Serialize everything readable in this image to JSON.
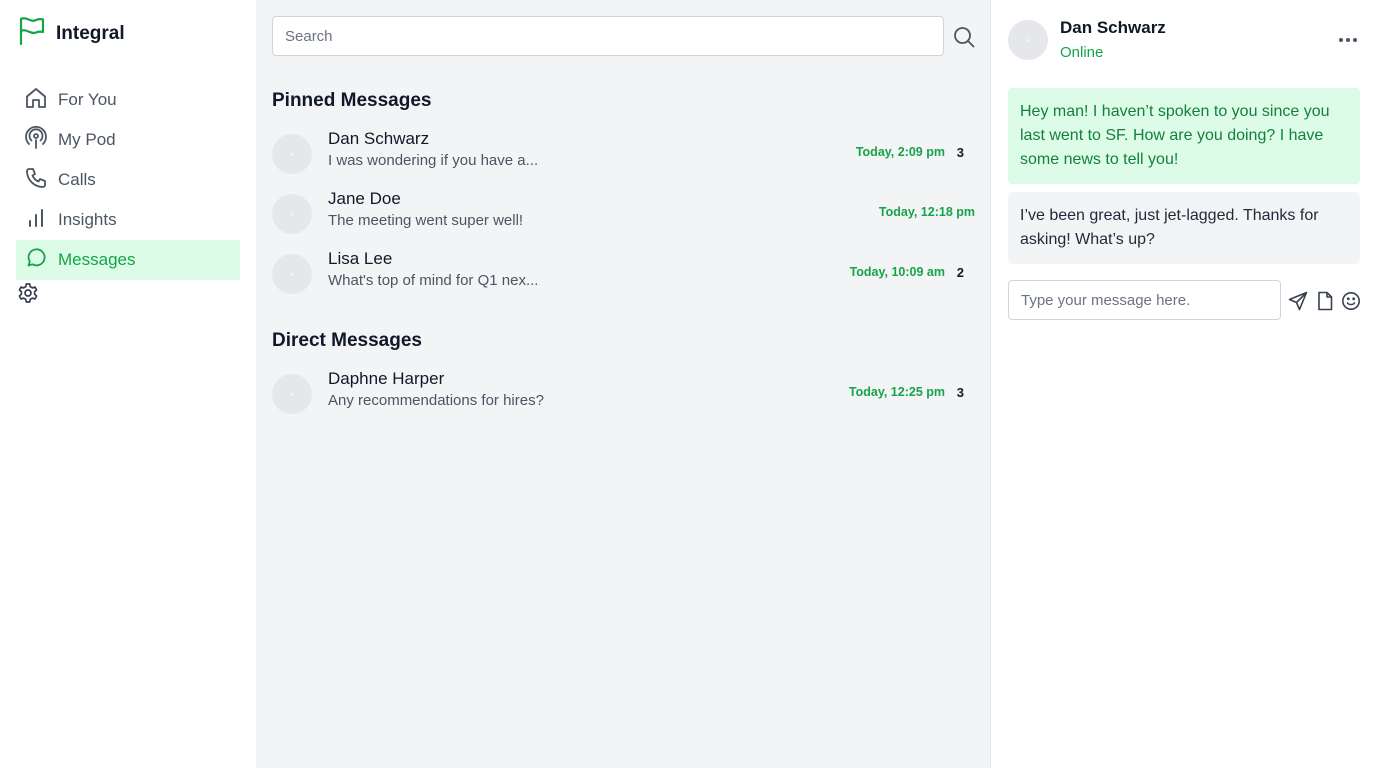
{
  "app": {
    "name": "Integral",
    "brand_color": "#16a34a"
  },
  "sidebar": {
    "items": [
      {
        "label": "For You",
        "icon": "home-icon"
      },
      {
        "label": "My Pod",
        "icon": "podcast-icon"
      },
      {
        "label": "Calls",
        "icon": "phone-icon"
      },
      {
        "label": "Insights",
        "icon": "bar-chart-icon"
      },
      {
        "label": "Messages",
        "icon": "message-circle-icon",
        "active": true
      }
    ],
    "settings_icon": "gear-icon"
  },
  "search": {
    "placeholder": "Search",
    "value": ""
  },
  "pinned": {
    "title": "Pinned Messages",
    "items": [
      {
        "name": "Dan Schwarz",
        "preview": "I was wondering if you have a...",
        "time": "Today, 2:09 pm",
        "count": "3"
      },
      {
        "name": "Jane Doe",
        "preview": "The meeting went super well!",
        "time": "Today, 12:18 pm",
        "count": ""
      },
      {
        "name": "Lisa Lee",
        "preview": "What's top of mind for Q1 nex...",
        "time": "Today, 10:09 am",
        "count": "2"
      }
    ]
  },
  "direct": {
    "title": "Direct Messages",
    "items": [
      {
        "name": "Daphne Harper",
        "preview": "Any recommendations for hires?",
        "time": "Today, 12:25 pm",
        "count": "3"
      }
    ]
  },
  "chat": {
    "name": "Dan Schwarz",
    "status": "Online",
    "messages": [
      {
        "direction": "sent",
        "text": "Hey man! I haven’t spoken to you since you last went to SF. How are you doing? I have some news to tell you!"
      },
      {
        "direction": "received",
        "text": "I’ve been great, just jet-lagged. Thanks for asking! What’s up?"
      }
    ],
    "compose_placeholder": "Type your message here.",
    "compose_value": ""
  }
}
